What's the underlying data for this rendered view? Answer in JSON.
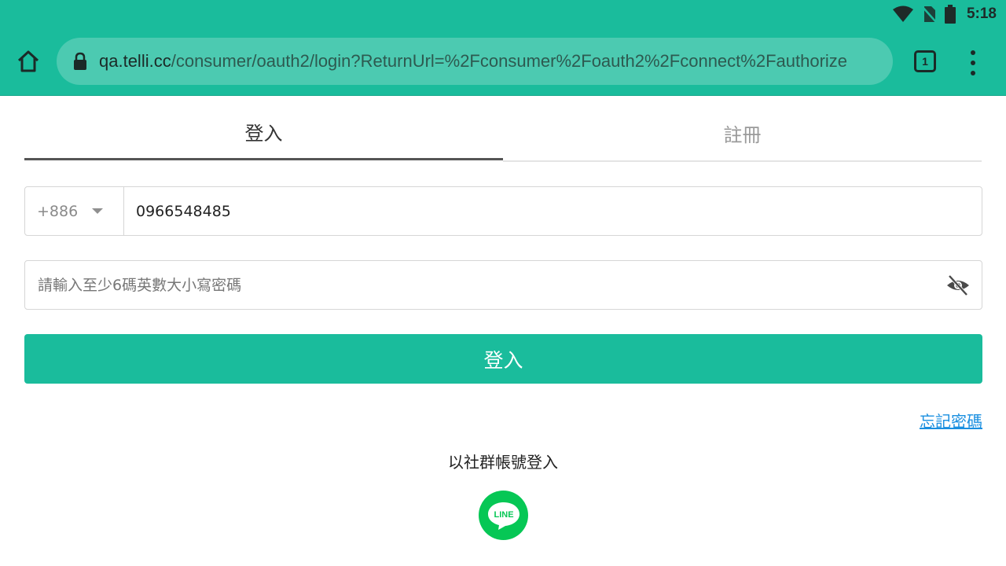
{
  "status_bar": {
    "time": "5:18",
    "icons": [
      "wifi-icon",
      "no-sim-icon",
      "battery-icon"
    ]
  },
  "browser": {
    "url_host": "qa.telli.cc",
    "url_path": "/consumer/oauth2/login?ReturnUrl=%2Fconsumer%2Foauth2%2Fconnect%2Fauthorize",
    "tab_count": "1",
    "icons": [
      "home-icon",
      "lock-icon",
      "tab-switcher-icon",
      "more-vert-icon"
    ]
  },
  "tabs": {
    "login_label": "登入",
    "register_label": "註冊",
    "active": "login"
  },
  "form": {
    "country_code": "+886",
    "phone_value": "0966548485",
    "password_placeholder": "請輸入至少6碼英數大小寫密碼",
    "submit_label": "登入",
    "forgot_label": "忘記密碼"
  },
  "social": {
    "label": "以社群帳號登入",
    "line_label": "LINE"
  },
  "colors": {
    "accent": "#1abc9c",
    "link": "#1a8fe0",
    "line_green": "#06c755"
  }
}
